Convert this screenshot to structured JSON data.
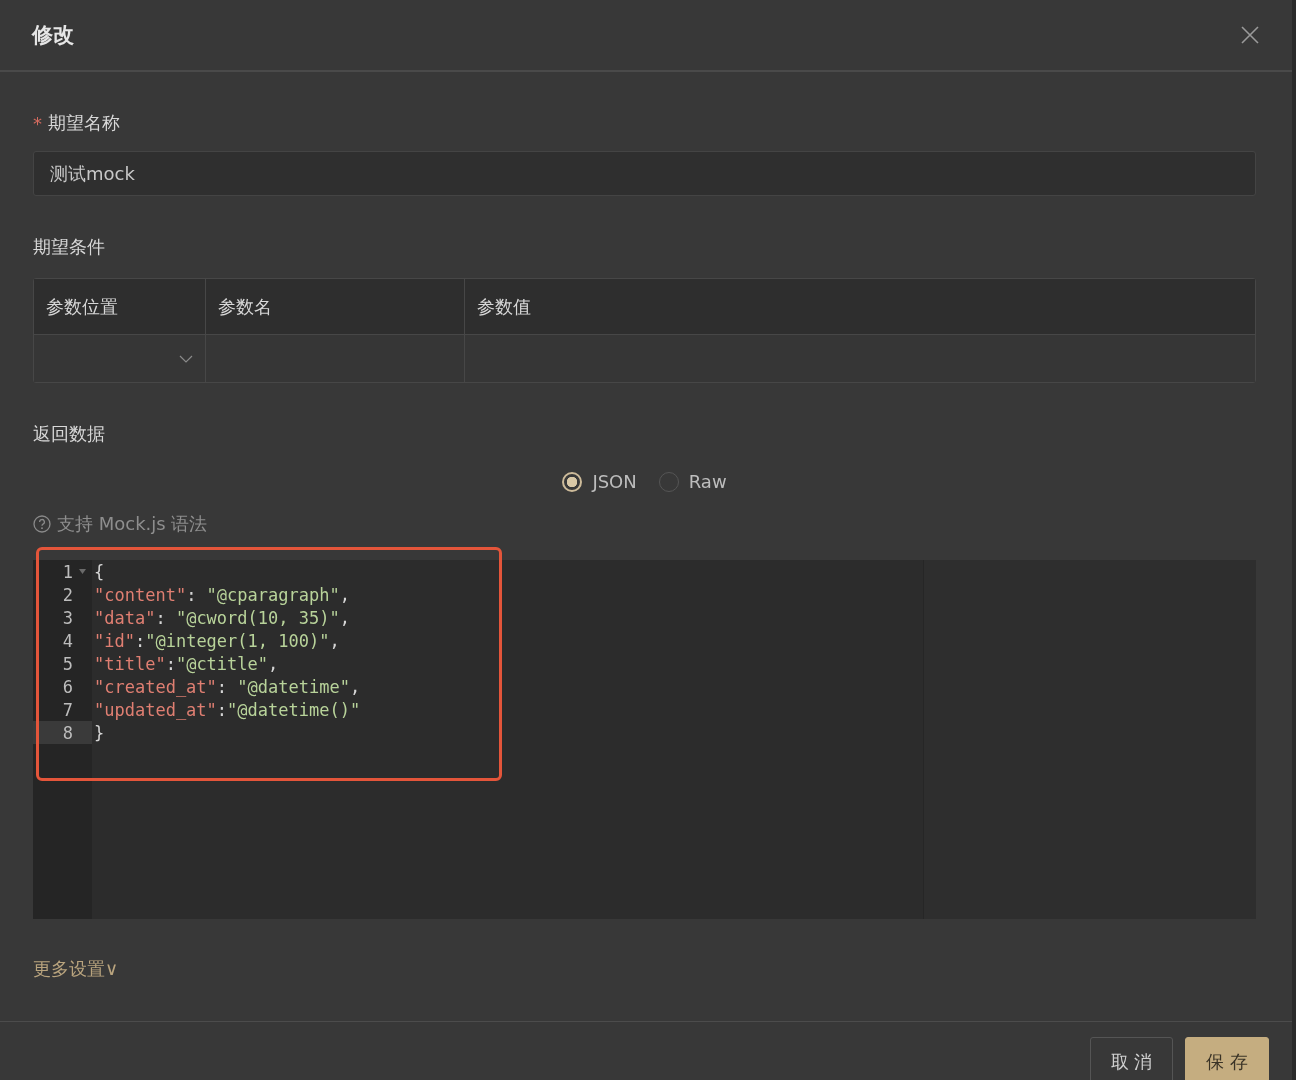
{
  "dialog": {
    "title": "修改"
  },
  "name_field": {
    "required_mark": "*",
    "label": "期望名称",
    "value": "测试mock"
  },
  "conditions": {
    "label": "期望条件",
    "columns": [
      "参数位置",
      "参数名",
      "参数值"
    ]
  },
  "response": {
    "label": "返回数据",
    "formats": [
      {
        "label": "JSON",
        "selected": true
      },
      {
        "label": "Raw",
        "selected": false
      }
    ],
    "hint": "支持 Mock.js 语法",
    "code_lines": [
      {
        "number": "1",
        "kind": "brace",
        "text": "{",
        "foldable": true,
        "active": false
      },
      {
        "number": "2",
        "kind": "pair",
        "key": "\"content\"",
        "sep": ": ",
        "value": "\"@cparagraph\"",
        "trail": ",",
        "foldable": false,
        "active": false
      },
      {
        "number": "3",
        "kind": "pair",
        "key": "\"data\"",
        "sep": ": ",
        "value": "\"@cword(10, 35)\"",
        "trail": ",",
        "foldable": false,
        "active": false
      },
      {
        "number": "4",
        "kind": "pair",
        "key": "\"id\"",
        "sep": ":",
        "value": "\"@integer(1, 100)\"",
        "trail": ",",
        "foldable": false,
        "active": false
      },
      {
        "number": "5",
        "kind": "pair",
        "key": "\"title\"",
        "sep": ":",
        "value": "\"@ctitle\"",
        "trail": ",",
        "foldable": false,
        "active": false
      },
      {
        "number": "6",
        "kind": "pair",
        "key": "\"created_at\"",
        "sep": ": ",
        "value": "\"@datetime\"",
        "trail": ",",
        "foldable": false,
        "active": false
      },
      {
        "number": "7",
        "kind": "pair",
        "key": "\"updated_at\"",
        "sep": ":",
        "value": "\"@datetime()\"",
        "foldable": false,
        "active": false
      },
      {
        "number": "8",
        "kind": "brace",
        "text": "}",
        "foldable": false,
        "active": true
      }
    ]
  },
  "more_settings": {
    "label": "更多设置∨"
  },
  "buttons": [
    {
      "label": "取 消",
      "kind": "secondary"
    },
    {
      "label": "保 存",
      "kind": "primary"
    }
  ]
}
